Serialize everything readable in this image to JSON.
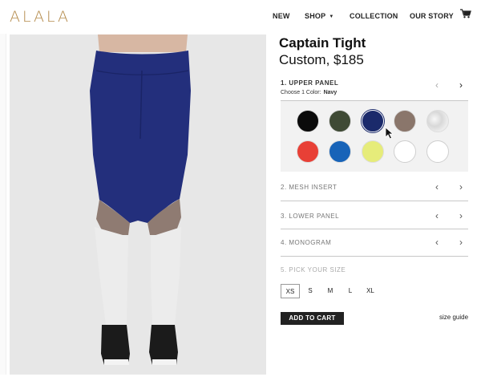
{
  "brand": {
    "logo_text": "ALALA",
    "accent": "#b48a4a"
  },
  "nav": {
    "items": [
      {
        "label": "NEW"
      },
      {
        "label": "SHOP"
      },
      {
        "label": "COLLECTION"
      },
      {
        "label": "OUR STORY"
      }
    ],
    "shop_caret": "▼",
    "cart_icon": "cart-icon"
  },
  "product": {
    "name": "Captain Tight",
    "subtitle": "Custom, $185"
  },
  "panels": {
    "upper": {
      "label": "1. UPPER PANEL",
      "choose_text": "Choose 1 Color:",
      "selected_color": "Navy",
      "prev": "‹",
      "next": "›"
    },
    "mesh": {
      "label": "2. MESH INSERT",
      "prev": "‹",
      "next": "›"
    },
    "lower": {
      "label": "3. LOWER PANEL",
      "prev": "‹",
      "next": "›"
    },
    "monogram": {
      "label": "4. MONOGRAM",
      "prev": "‹",
      "next": "›"
    },
    "size": {
      "label": "5. PICK YOUR SIZE"
    }
  },
  "swatches": {
    "colors": [
      "#0b0b0b",
      "#3f4a35",
      "#1b2a6b",
      "#8a766b",
      "#e8e8e8",
      "#e84036",
      "#1763b8",
      "#e6ec7a",
      "#ffffff",
      "#ffffff"
    ]
  },
  "sizes": {
    "options": [
      "XS",
      "S",
      "M",
      "L",
      "XL"
    ],
    "selected": "XS"
  },
  "actions": {
    "add_to_cart": "ADD TO CART",
    "size_guide": "size guide"
  },
  "photo": {
    "colors": {
      "background": "#e7e7e7",
      "upper": "#232f7c",
      "mesh": "#8f7b72",
      "lower": "#ececec",
      "shoe": "#1b1b1b"
    }
  }
}
